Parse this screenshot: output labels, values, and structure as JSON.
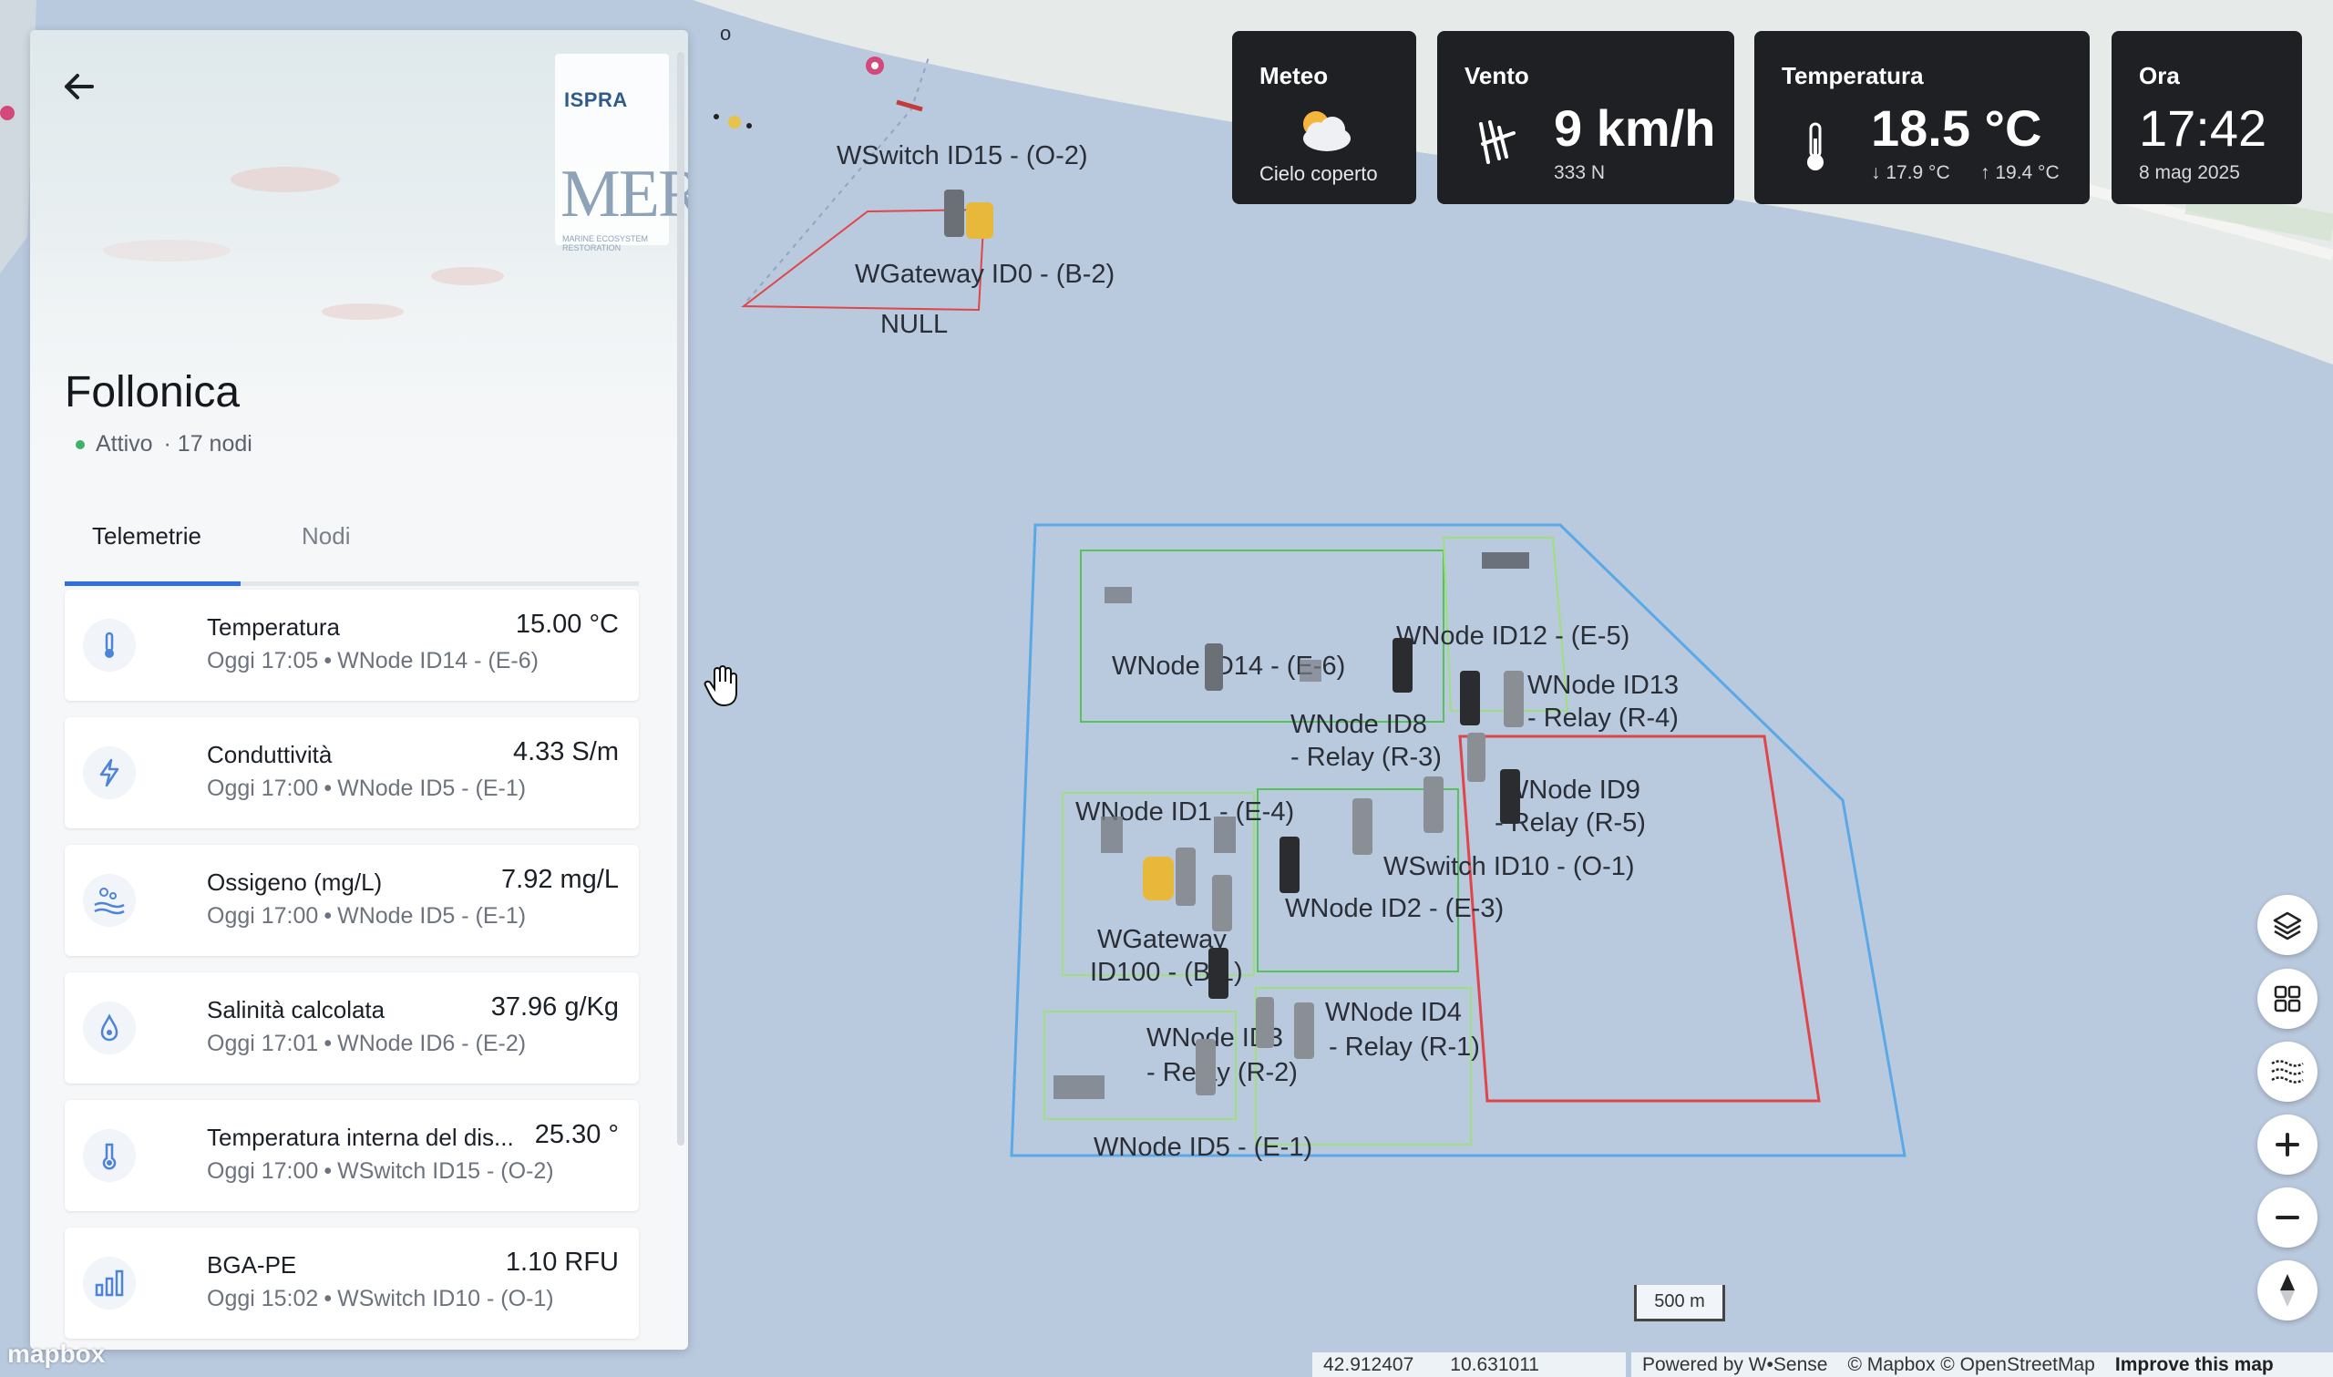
{
  "site": {
    "title": "Follonica",
    "status": "Attivo",
    "nodes_count": "· 17 nodi",
    "logo_ispra": "ISPRA",
    "logo_mer": "MER",
    "logo_mer_sub": "MARINE ECOSYSTEM RESTORATION"
  },
  "tabs": [
    {
      "label": "Telemetrie",
      "active": true
    },
    {
      "label": "Nodi",
      "active": false
    }
  ],
  "telemetry": [
    {
      "icon": "thermometer-icon",
      "name": "Temperatura",
      "value": "15.00 °C",
      "time": "Oggi 17:05",
      "node": "WNode ID14 - (E-6)"
    },
    {
      "icon": "lightning-icon",
      "name": "Conduttività",
      "value": "4.33 S/m",
      "time": "Oggi 17:00",
      "node": "WNode ID5 - (E-1)"
    },
    {
      "icon": "oxygen-icon",
      "name": "Ossigeno (mg/L)",
      "value": "7.92 mg/L",
      "time": "Oggi 17:00",
      "node": "WNode ID5 - (E-1)"
    },
    {
      "icon": "drop-icon",
      "name": "Salinità calcolata",
      "value": "37.96 g/Kg",
      "time": "Oggi 17:01",
      "node": "WNode ID6 - (E-2)"
    },
    {
      "icon": "internal-temp-icon",
      "name": "Temperatura interna del dis...",
      "value": "25.30 °",
      "time": "Oggi 17:00",
      "node": "WSwitch ID15 - (O-2)"
    },
    {
      "icon": "bar-chart-icon",
      "name": "BGA-PE",
      "value": "1.10 RFU",
      "time": "Oggi 15:02",
      "node": "WSwitch ID10 - (O-1)"
    }
  ],
  "weather": {
    "meteo": {
      "title": "Meteo",
      "condition": "Cielo coperto",
      "icon": "cloudy-icon"
    },
    "vento": {
      "title": "Vento",
      "speed": "9 km/h",
      "direction": "333 N",
      "icon": "wind-icon"
    },
    "temperatura": {
      "title": "Temperatura",
      "value": "18.5 °C",
      "min": "↓ 17.9 °C",
      "max": "↑ 19.4 °C",
      "icon": "thermometer-icon"
    },
    "ora": {
      "title": "Ora",
      "time": "17:42",
      "date": "8 mag 2025"
    }
  },
  "map": {
    "labels": {
      "wswitch15": "WSwitch ID15 - (O-2)",
      "wgateway0": "WGateway ID0 - (B-2)",
      "null_label": "NULL",
      "wnode12": "WNode ID12 - (E-5)",
      "wnode14": "WNode ID14 - (E-6)",
      "wnode13_a": "WNode ID13",
      "wnode13_b": "- Relay (R-4)",
      "wnode8_a": "WNode ID8",
      "wnode8_b": "- Relay (R-3)",
      "wnode9_a": "WNode ID9",
      "wnode9_b": "- Relay (R-5)",
      "wnode1": "WNode ID1 - (E-4)",
      "wswitch10": "WSwitch ID10 - (O-1)",
      "wnode2": "WNode ID2 - (E-3)",
      "wgateway100_a": "WGateway",
      "wgateway100_b": "ID100 - (B-1)",
      "wnode4_a": "WNode ID4",
      "wnode4_b": "- Relay (R-1)",
      "wnode3_a": "WNode ID3",
      "wnode3_b": "- Relay (R-2)",
      "wnode5": "WNode ID5 - (E-1)",
      "map_o": "o"
    },
    "colors": {
      "sea": "#b9c9de",
      "land": "#e6eae8",
      "zone_blue": "#5aa9e6",
      "zone_green": "#56c25a",
      "zone_red": "#e0454a"
    },
    "scale": "500 m",
    "coords": {
      "lat": "42.912407",
      "lon": "10.631011"
    },
    "powered_by": "Powered by W•Sense",
    "attribution": "© Mapbox © OpenStreetMap",
    "improve": "Improve this map",
    "mapbox_logo": "mapbox"
  },
  "controls": [
    {
      "name": "layers-button",
      "icon": "layers-icon"
    },
    {
      "name": "grid-button",
      "icon": "grid-icon"
    },
    {
      "name": "waves-button",
      "icon": "waves-icon"
    },
    {
      "name": "zoom-in-button",
      "icon": "plus-icon"
    },
    {
      "name": "zoom-out-button",
      "icon": "minus-icon"
    },
    {
      "name": "compass-button",
      "icon": "compass-icon"
    }
  ]
}
